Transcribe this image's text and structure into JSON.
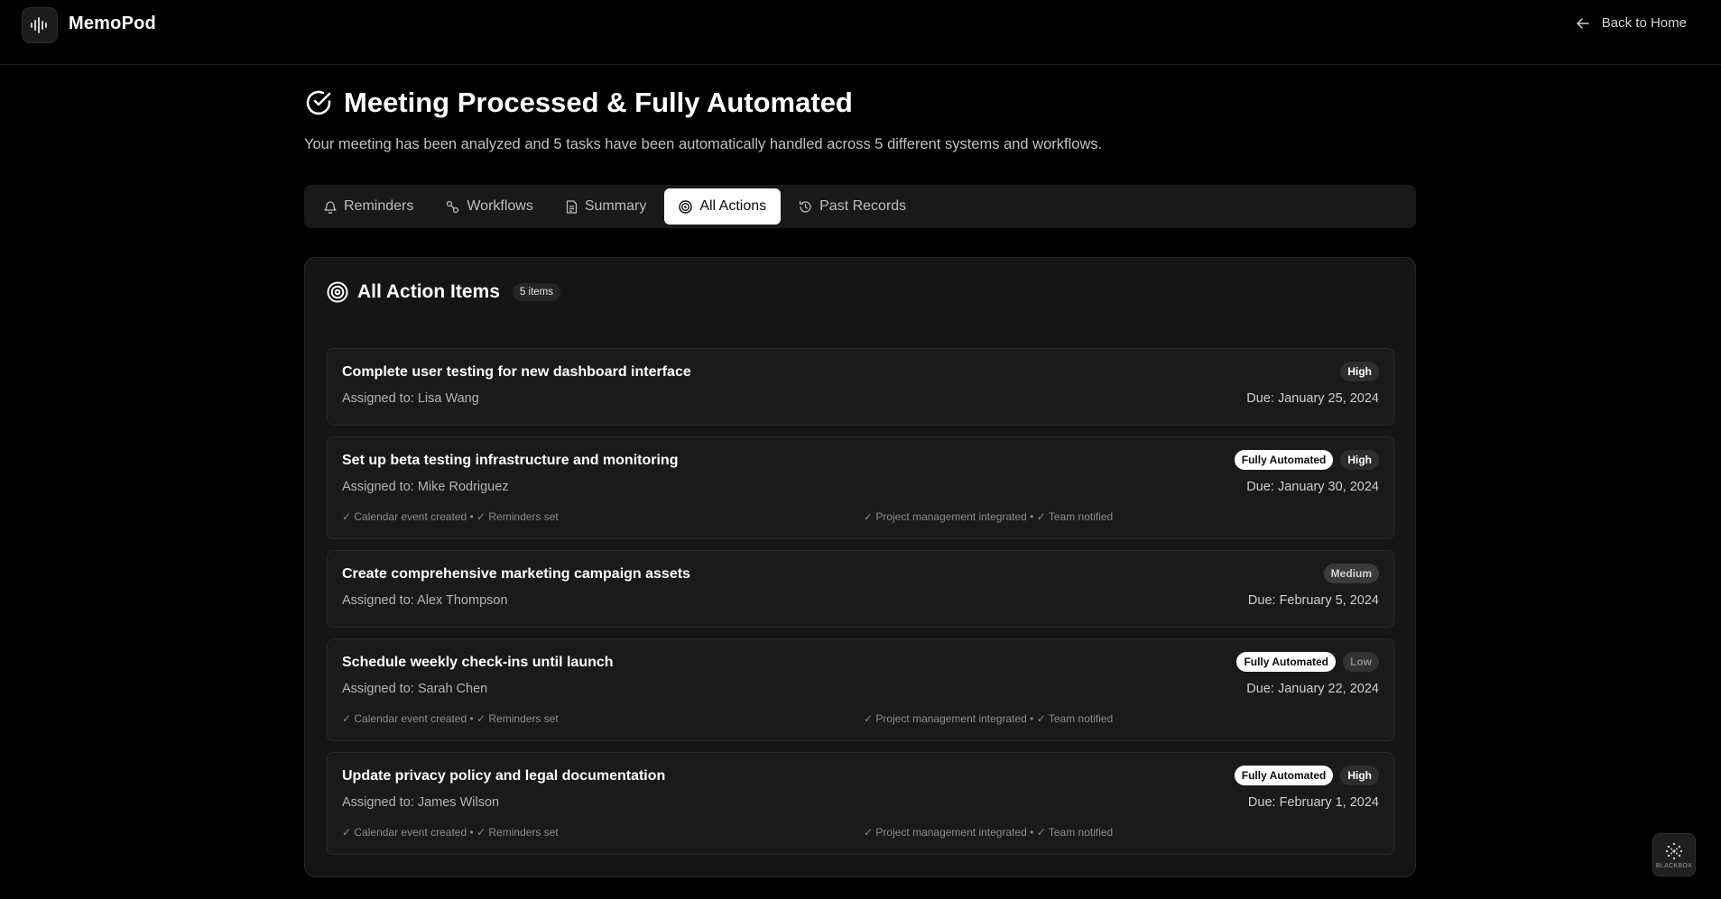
{
  "header": {
    "brand": "MemoPod",
    "back_label": "Back to Home"
  },
  "page": {
    "title": "Meeting Processed & Fully Automated",
    "subtitle": "Your meeting has been analyzed and 5 tasks have been automatically handled across 5 different systems and workflows."
  },
  "tabs": [
    {
      "label": "Reminders",
      "icon": "bell-icon"
    },
    {
      "label": "Workflows",
      "icon": "workflow-icon"
    },
    {
      "label": "Summary",
      "icon": "document-icon"
    },
    {
      "label": "All Actions",
      "icon": "target-icon",
      "active": true
    },
    {
      "label": "Past Records",
      "icon": "history-icon"
    }
  ],
  "actions": {
    "title": "All Action Items",
    "count_label": "5 items",
    "items": [
      {
        "title": "Complete user testing for new dashboard interface",
        "assignee": "Assigned to: Lisa Wang",
        "due": "Due: January 25, 2024",
        "automated_label": "",
        "priority": "High",
        "status_left": "",
        "status_right": ""
      },
      {
        "title": "Set up beta testing infrastructure and monitoring",
        "assignee": "Assigned to: Mike Rodriguez",
        "due": "Due: January 30, 2024",
        "automated_label": "Fully Automated",
        "priority": "High",
        "status_left": "✓ Calendar event created • ✓ Reminders set",
        "status_right": "✓ Project management integrated • ✓ Team notified"
      },
      {
        "title": "Create comprehensive marketing campaign assets",
        "assignee": "Assigned to: Alex Thompson",
        "due": "Due: February 5, 2024",
        "automated_label": "",
        "priority": "Medium",
        "status_left": "",
        "status_right": ""
      },
      {
        "title": "Schedule weekly check-ins until launch",
        "assignee": "Assigned to: Sarah Chen",
        "due": "Due: January 22, 2024",
        "automated_label": "Fully Automated",
        "priority": "Low",
        "status_left": "✓ Calendar event created • ✓ Reminders set",
        "status_right": "✓ Project management integrated • ✓ Team notified"
      },
      {
        "title": "Update privacy policy and legal documentation",
        "assignee": "Assigned to: James Wilson",
        "due": "Due: February 1, 2024",
        "automated_label": "Fully Automated",
        "priority": "High",
        "status_left": "✓ Calendar event created • ✓ Reminders set",
        "status_right": "✓ Project management integrated • ✓ Team notified"
      }
    ]
  },
  "watermark": {
    "label": "BLACKBOX"
  },
  "colors": {
    "background": "#000000",
    "card": "#151515",
    "accent_active_tab": "#ffffff"
  }
}
